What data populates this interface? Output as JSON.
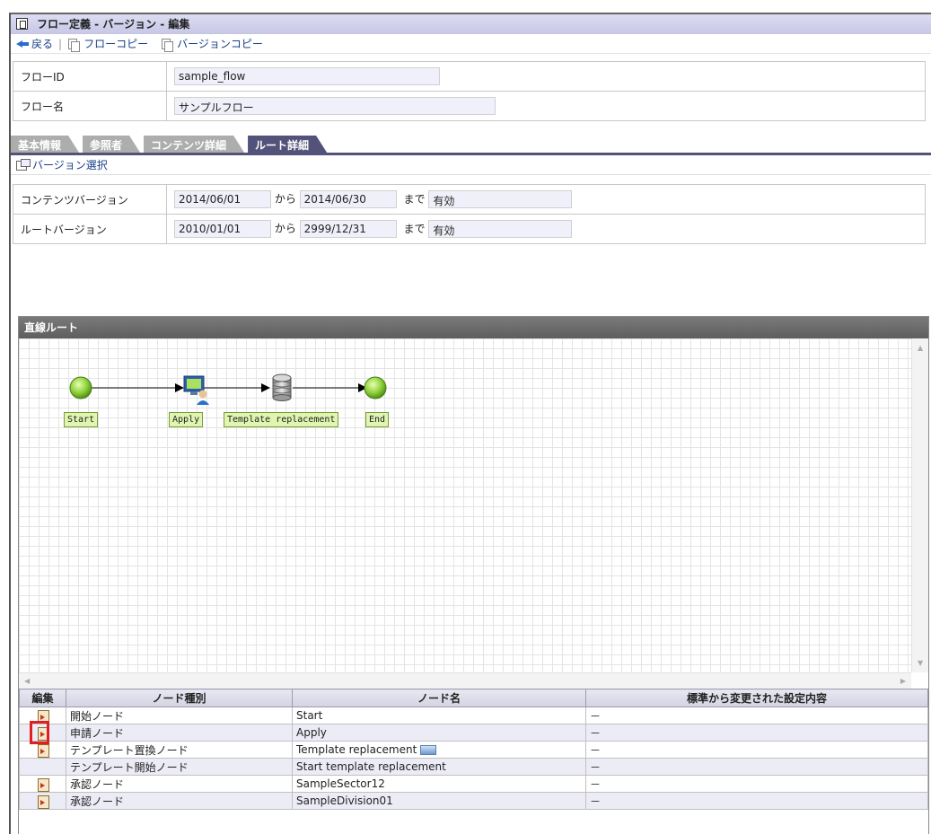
{
  "window": {
    "title": "フロー定義 - バージョン - 編集"
  },
  "toolbar": {
    "back_label": "戻る",
    "flow_copy_label": "フローコピー",
    "version_copy_label": "バージョンコピー"
  },
  "flow": {
    "id_label": "フローID",
    "id_value": "sample_flow",
    "name_label": "フロー名",
    "name_value": "サンプルフロー"
  },
  "tabs": [
    {
      "label": "基本情報",
      "active": false
    },
    {
      "label": "参照者",
      "active": false
    },
    {
      "label": "コンテンツ詳細",
      "active": false
    },
    {
      "label": "ルート詳細",
      "active": true
    }
  ],
  "version_select_label": "バージョン選択",
  "versions": {
    "content": {
      "label": "コンテンツバージョン",
      "from": "2014/06/01",
      "kara": "から",
      "to": "2014/06/30",
      "made": "まで",
      "status": "有効"
    },
    "route": {
      "label": "ルートバージョン",
      "from": "2010/01/01",
      "kara": "から",
      "to": "2999/12/31",
      "made": "まで",
      "status": "有効"
    }
  },
  "route": {
    "header": "直線ルート",
    "nodes": [
      {
        "label": "Start",
        "type": "start-icon"
      },
      {
        "label": "Apply",
        "type": "user-computer-icon"
      },
      {
        "label": "Template replacement",
        "type": "database-icon"
      },
      {
        "label": "End",
        "type": "end-icon"
      }
    ]
  },
  "node_table": {
    "headers": [
      "編集",
      "ノード種別",
      "ノード名",
      "標準から変更された設定内容"
    ],
    "rows": [
      {
        "edit": true,
        "type": "開始ノード",
        "name": "Start",
        "changes": "－",
        "extra_icon": false
      },
      {
        "edit": true,
        "type": "申請ノード",
        "name": "Apply",
        "changes": "－",
        "extra_icon": false,
        "highlight": true
      },
      {
        "edit": true,
        "type": "テンプレート置換ノード",
        "name": "Template replacement",
        "changes": "－",
        "extra_icon": true
      },
      {
        "edit": false,
        "type": "テンプレート開始ノード",
        "name": "Start template replacement",
        "changes": "－",
        "extra_icon": false
      },
      {
        "edit": true,
        "type": "承認ノード",
        "name": "SampleSector12",
        "changes": "－",
        "extra_icon": false
      },
      {
        "edit": true,
        "type": "承認ノード",
        "name": "SampleDivision01",
        "changes": "－",
        "extra_icon": false
      }
    ]
  },
  "colors": {
    "accent_tab": "#52527a",
    "link": "#1a3f86",
    "node_green": "#7cc73a",
    "highlight": "#e02020"
  }
}
